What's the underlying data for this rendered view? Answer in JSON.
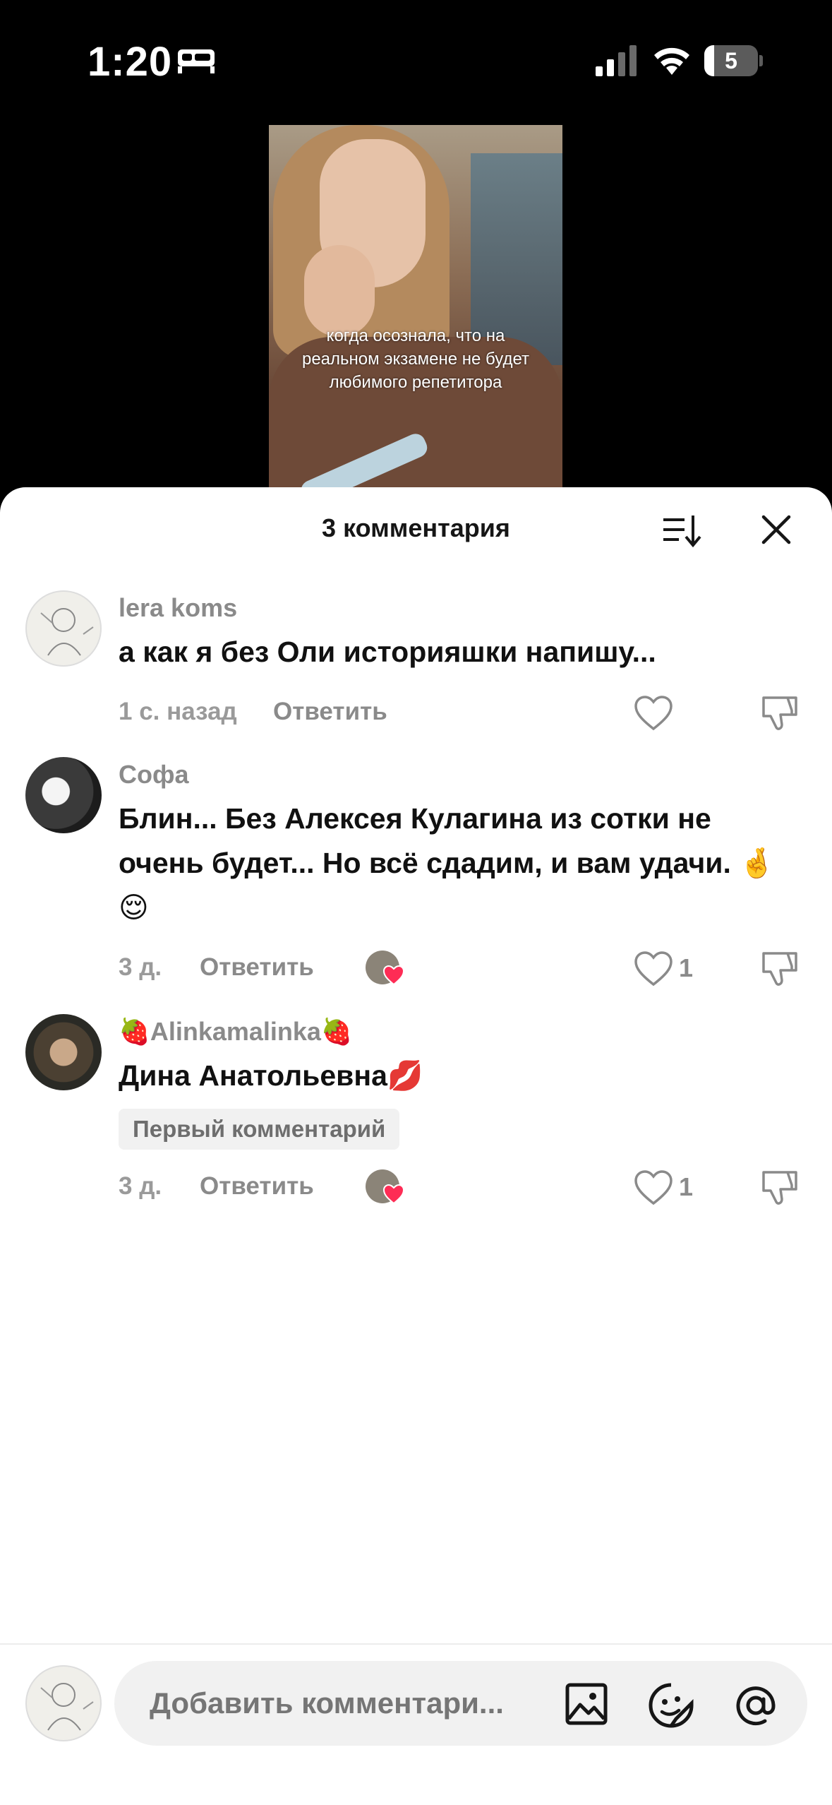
{
  "status_bar": {
    "time": "1:20",
    "battery_level": "5",
    "icons": [
      "sleep-icon",
      "cellular-signal-icon",
      "wifi-icon",
      "battery-icon"
    ]
  },
  "video": {
    "caption": "когда осознала, что на реальном экзамене не будет любимого репетитора"
  },
  "comments_sheet": {
    "title": "3 комментария",
    "reply_label": "Ответить",
    "comments": [
      {
        "username": "lera koms",
        "text": "а как я без Оли историяшки напишу...",
        "time": "1 с. назад",
        "likes": ""
      },
      {
        "username": "Софа",
        "text": "Блин... Без Алексея Кулагина из сотки не очень будет... Но всё сдадим, и вам удачи. 🤞😌",
        "time": "3 д.",
        "likes": "1"
      },
      {
        "username": "🍓Alinkamalinka🍓",
        "text": "Дина Анатольевна💋",
        "badge": "Первый комментарий",
        "time": "3 д.",
        "likes": "1"
      }
    ]
  },
  "composer": {
    "placeholder": "Добавить комментари..."
  },
  "colors": {
    "accent_heart": "#fe2c55",
    "sheet_bg": "#ffffff",
    "input_bg": "#f1f1f1"
  }
}
